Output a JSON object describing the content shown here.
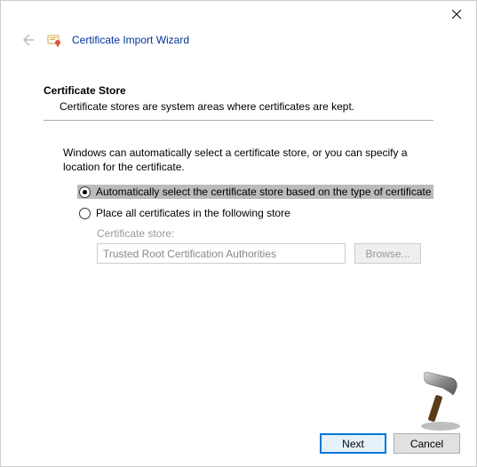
{
  "window": {
    "title": "Certificate Import Wizard"
  },
  "section": {
    "heading": "Certificate Store",
    "description": "Certificate stores are system areas where certificates are kept."
  },
  "body": {
    "intro": "Windows can automatically select a certificate store, or you can specify a location for the certificate.",
    "radio_auto": "Automatically select the certificate store based on the type of certificate",
    "radio_manual": "Place all certificates in the following store",
    "store_label": "Certificate store:",
    "store_value": "Trusted Root Certification Authorities",
    "browse_label": "Browse..."
  },
  "footer": {
    "next": "Next",
    "cancel": "Cancel"
  }
}
